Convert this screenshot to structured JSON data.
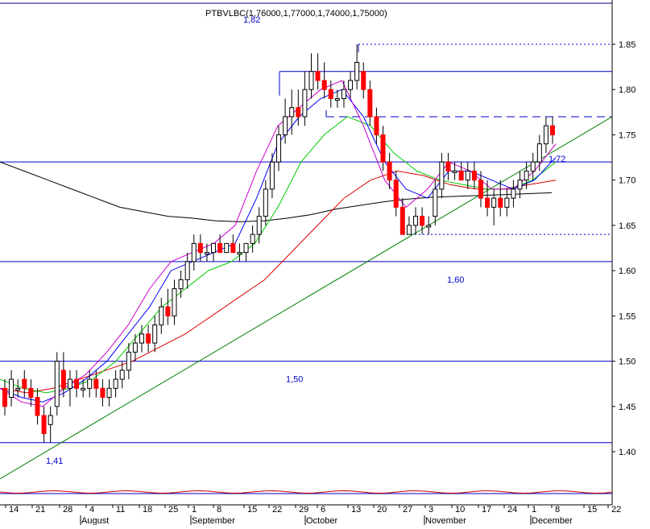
{
  "chart_data": {
    "type": "candlestick",
    "title": "PTBVLBC(1,76000,1,77000,1,74000,1,75000)",
    "ylim": [
      1.36,
      1.89
    ],
    "y_ticks": [
      "1.85",
      "1.80",
      "1.75",
      "1.70",
      "1.65",
      "1.60",
      "1.55",
      "1.50",
      "1.45",
      "1.40"
    ],
    "x_day_ticks": [
      "14",
      "21",
      "28",
      "4",
      "11",
      "18",
      "25",
      "1",
      "8",
      "15",
      "22",
      "29",
      "6",
      "13",
      "20",
      "27",
      "3",
      "10",
      "17",
      "24",
      "1",
      "8",
      "15",
      "22"
    ],
    "months": [
      "August",
      "September",
      "October",
      "November",
      "December"
    ],
    "horizontal_levels": [
      {
        "value": 1.72,
        "label": "1,72"
      },
      {
        "value": 1.61,
        "label": "1,60"
      },
      {
        "value": 1.5,
        "label": "1,50"
      },
      {
        "value": 1.41,
        "label": "1,41"
      }
    ],
    "resistance_box": {
      "top": 1.82,
      "bottom": 1.77,
      "dashed_top": 1.85,
      "dashed_support": 1.64
    },
    "top_marker": "1,82",
    "colors": {
      "up_candle": "#ffffff",
      "down_candle": "#ff0000",
      "levels": "#0000cc",
      "trendline": "#008000",
      "ma_black": "#000000",
      "ma_red": "#dd0000",
      "ma_green": "#00cc00",
      "ma_blue": "#0000ff",
      "ma_magenta": "#cc00cc"
    },
    "candles": [
      {
        "o": 1.47,
        "h": 1.48,
        "l": 1.44,
        "c": 1.45
      },
      {
        "o": 1.46,
        "h": 1.49,
        "l": 1.45,
        "c": 1.48
      },
      {
        "o": 1.47,
        "h": 1.48,
        "l": 1.46,
        "c": 1.47
      },
      {
        "o": 1.48,
        "h": 1.49,
        "l": 1.46,
        "c": 1.47
      },
      {
        "o": 1.47,
        "h": 1.48,
        "l": 1.45,
        "c": 1.46
      },
      {
        "o": 1.46,
        "h": 1.47,
        "l": 1.43,
        "c": 1.44
      },
      {
        "o": 1.44,
        "h": 1.45,
        "l": 1.41,
        "c": 1.42
      },
      {
        "o": 1.43,
        "h": 1.45,
        "l": 1.41,
        "c": 1.44
      },
      {
        "o": 1.45,
        "h": 1.51,
        "l": 1.44,
        "c": 1.5
      },
      {
        "o": 1.49,
        "h": 1.51,
        "l": 1.46,
        "c": 1.47
      },
      {
        "o": 1.47,
        "h": 1.49,
        "l": 1.45,
        "c": 1.48
      },
      {
        "o": 1.48,
        "h": 1.49,
        "l": 1.46,
        "c": 1.47
      },
      {
        "o": 1.47,
        "h": 1.48,
        "l": 1.46,
        "c": 1.47
      },
      {
        "o": 1.47,
        "h": 1.49,
        "l": 1.46,
        "c": 1.48
      },
      {
        "o": 1.48,
        "h": 1.49,
        "l": 1.46,
        "c": 1.47
      },
      {
        "o": 1.47,
        "h": 1.48,
        "l": 1.45,
        "c": 1.46
      },
      {
        "o": 1.46,
        "h": 1.48,
        "l": 1.45,
        "c": 1.47
      },
      {
        "o": 1.47,
        "h": 1.49,
        "l": 1.46,
        "c": 1.48
      },
      {
        "o": 1.48,
        "h": 1.5,
        "l": 1.47,
        "c": 1.49
      },
      {
        "o": 1.49,
        "h": 1.52,
        "l": 1.48,
        "c": 1.51
      },
      {
        "o": 1.51,
        "h": 1.53,
        "l": 1.5,
        "c": 1.52
      },
      {
        "o": 1.52,
        "h": 1.54,
        "l": 1.51,
        "c": 1.53
      },
      {
        "o": 1.53,
        "h": 1.54,
        "l": 1.51,
        "c": 1.52
      },
      {
        "o": 1.52,
        "h": 1.55,
        "l": 1.51,
        "c": 1.54
      },
      {
        "o": 1.54,
        "h": 1.57,
        "l": 1.53,
        "c": 1.56
      },
      {
        "o": 1.56,
        "h": 1.58,
        "l": 1.54,
        "c": 1.55
      },
      {
        "o": 1.55,
        "h": 1.59,
        "l": 1.54,
        "c": 1.58
      },
      {
        "o": 1.58,
        "h": 1.6,
        "l": 1.57,
        "c": 1.59
      },
      {
        "o": 1.59,
        "h": 1.62,
        "l": 1.58,
        "c": 1.61
      },
      {
        "o": 1.61,
        "h": 1.64,
        "l": 1.6,
        "c": 1.63
      },
      {
        "o": 1.63,
        "h": 1.64,
        "l": 1.61,
        "c": 1.62
      },
      {
        "o": 1.62,
        "h": 1.63,
        "l": 1.61,
        "c": 1.62
      },
      {
        "o": 1.62,
        "h": 1.63,
        "l": 1.61,
        "c": 1.63
      },
      {
        "o": 1.63,
        "h": 1.64,
        "l": 1.62,
        "c": 1.62
      },
      {
        "o": 1.62,
        "h": 1.63,
        "l": 1.62,
        "c": 1.63
      },
      {
        "o": 1.63,
        "h": 1.64,
        "l": 1.62,
        "c": 1.62
      },
      {
        "o": 1.62,
        "h": 1.63,
        "l": 1.61,
        "c": 1.62
      },
      {
        "o": 1.62,
        "h": 1.63,
        "l": 1.61,
        "c": 1.63
      },
      {
        "o": 1.63,
        "h": 1.65,
        "l": 1.62,
        "c": 1.64
      },
      {
        "o": 1.64,
        "h": 1.67,
        "l": 1.63,
        "c": 1.66
      },
      {
        "o": 1.66,
        "h": 1.7,
        "l": 1.65,
        "c": 1.69
      },
      {
        "o": 1.69,
        "h": 1.73,
        "l": 1.68,
        "c": 1.72
      },
      {
        "o": 1.72,
        "h": 1.76,
        "l": 1.71,
        "c": 1.75
      },
      {
        "o": 1.75,
        "h": 1.79,
        "l": 1.74,
        "c": 1.77
      },
      {
        "o": 1.77,
        "h": 1.8,
        "l": 1.75,
        "c": 1.78
      },
      {
        "o": 1.78,
        "h": 1.8,
        "l": 1.76,
        "c": 1.77
      },
      {
        "o": 1.77,
        "h": 1.82,
        "l": 1.76,
        "c": 1.8
      },
      {
        "o": 1.8,
        "h": 1.84,
        "l": 1.79,
        "c": 1.82
      },
      {
        "o": 1.82,
        "h": 1.84,
        "l": 1.8,
        "c": 1.81
      },
      {
        "o": 1.81,
        "h": 1.83,
        "l": 1.79,
        "c": 1.8
      },
      {
        "o": 1.8,
        "h": 1.81,
        "l": 1.78,
        "c": 1.79
      },
      {
        "o": 1.79,
        "h": 1.8,
        "l": 1.78,
        "c": 1.79
      },
      {
        "o": 1.79,
        "h": 1.81,
        "l": 1.78,
        "c": 1.8
      },
      {
        "o": 1.8,
        "h": 1.82,
        "l": 1.79,
        "c": 1.81
      },
      {
        "o": 1.81,
        "h": 1.85,
        "l": 1.8,
        "c": 1.83
      },
      {
        "o": 1.82,
        "h": 1.83,
        "l": 1.79,
        "c": 1.8
      },
      {
        "o": 1.8,
        "h": 1.81,
        "l": 1.76,
        "c": 1.77
      },
      {
        "o": 1.77,
        "h": 1.78,
        "l": 1.74,
        "c": 1.75
      },
      {
        "o": 1.75,
        "h": 1.76,
        "l": 1.71,
        "c": 1.72
      },
      {
        "o": 1.72,
        "h": 1.73,
        "l": 1.69,
        "c": 1.7
      },
      {
        "o": 1.7,
        "h": 1.71,
        "l": 1.66,
        "c": 1.67
      },
      {
        "o": 1.67,
        "h": 1.68,
        "l": 1.64,
        "c": 1.64
      },
      {
        "o": 1.64,
        "h": 1.66,
        "l": 1.64,
        "c": 1.65
      },
      {
        "o": 1.65,
        "h": 1.67,
        "l": 1.64,
        "c": 1.66
      },
      {
        "o": 1.66,
        "h": 1.67,
        "l": 1.64,
        "c": 1.65
      },
      {
        "o": 1.65,
        "h": 1.66,
        "l": 1.64,
        "c": 1.65
      },
      {
        "o": 1.66,
        "h": 1.7,
        "l": 1.65,
        "c": 1.69
      },
      {
        "o": 1.69,
        "h": 1.73,
        "l": 1.68,
        "c": 1.72
      },
      {
        "o": 1.72,
        "h": 1.73,
        "l": 1.7,
        "c": 1.71
      },
      {
        "o": 1.71,
        "h": 1.72,
        "l": 1.7,
        "c": 1.71
      },
      {
        "o": 1.71,
        "h": 1.72,
        "l": 1.7,
        "c": 1.7
      },
      {
        "o": 1.7,
        "h": 1.72,
        "l": 1.69,
        "c": 1.71
      },
      {
        "o": 1.71,
        "h": 1.72,
        "l": 1.69,
        "c": 1.7
      },
      {
        "o": 1.7,
        "h": 1.71,
        "l": 1.67,
        "c": 1.68
      },
      {
        "o": 1.68,
        "h": 1.7,
        "l": 1.66,
        "c": 1.67
      },
      {
        "o": 1.67,
        "h": 1.69,
        "l": 1.65,
        "c": 1.68
      },
      {
        "o": 1.68,
        "h": 1.7,
        "l": 1.66,
        "c": 1.67
      },
      {
        "o": 1.67,
        "h": 1.69,
        "l": 1.66,
        "c": 1.68
      },
      {
        "o": 1.68,
        "h": 1.7,
        "l": 1.67,
        "c": 1.69
      },
      {
        "o": 1.69,
        "h": 1.71,
        "l": 1.68,
        "c": 1.7
      },
      {
        "o": 1.7,
        "h": 1.72,
        "l": 1.69,
        "c": 1.71
      },
      {
        "o": 1.71,
        "h": 1.73,
        "l": 1.7,
        "c": 1.72
      },
      {
        "o": 1.72,
        "h": 1.75,
        "l": 1.71,
        "c": 1.74
      },
      {
        "o": 1.74,
        "h": 1.77,
        "l": 1.73,
        "c": 1.76
      },
      {
        "o": 1.76,
        "h": 1.77,
        "l": 1.74,
        "c": 1.75
      }
    ],
    "moving_averages": [
      {
        "color": "#000000",
        "values": [
          1.72,
          1.71,
          1.7,
          1.69,
          1.68,
          1.67,
          1.665,
          1.66,
          1.658,
          1.655,
          1.654,
          1.655,
          1.658,
          1.662,
          1.668,
          1.672,
          1.676,
          1.679,
          1.681,
          1.682,
          1.683,
          1.684,
          1.685,
          1.686
        ]
      },
      {
        "color": "#dd0000",
        "values": [
          1.47,
          1.465,
          1.47,
          1.48,
          1.49,
          1.5,
          1.515,
          1.53,
          1.55,
          1.57,
          1.59,
          1.62,
          1.65,
          1.68,
          1.7,
          1.71,
          1.705,
          1.695,
          1.69,
          1.69,
          1.695,
          1.7
        ]
      },
      {
        "color": "#00cc00",
        "values": [
          1.48,
          1.47,
          1.465,
          1.47,
          1.48,
          1.5,
          1.53,
          1.56,
          1.58,
          1.6,
          1.61,
          1.63,
          1.67,
          1.72,
          1.75,
          1.77,
          1.76,
          1.73,
          1.71,
          1.7,
          1.695,
          1.69,
          1.69,
          1.7,
          1.72
        ]
      },
      {
        "color": "#0000ff",
        "values": [
          1.47,
          1.46,
          1.455,
          1.465,
          1.48,
          1.5,
          1.53,
          1.56,
          1.6,
          1.61,
          1.62,
          1.63,
          1.68,
          1.74,
          1.77,
          1.79,
          1.8,
          1.77,
          1.72,
          1.69,
          1.68,
          1.71,
          1.71,
          1.7,
          1.69,
          1.7,
          1.725
        ]
      },
      {
        "color": "#cc00cc",
        "values": [
          1.47,
          1.455,
          1.45,
          1.47,
          1.485,
          1.51,
          1.54,
          1.58,
          1.61,
          1.62,
          1.63,
          1.65,
          1.71,
          1.76,
          1.78,
          1.8,
          1.81,
          1.76,
          1.7,
          1.67,
          1.69,
          1.72,
          1.71,
          1.69,
          1.69,
          1.71,
          1.74
        ]
      }
    ],
    "trendline": {
      "from": 1.37,
      "to": 1.77
    }
  }
}
